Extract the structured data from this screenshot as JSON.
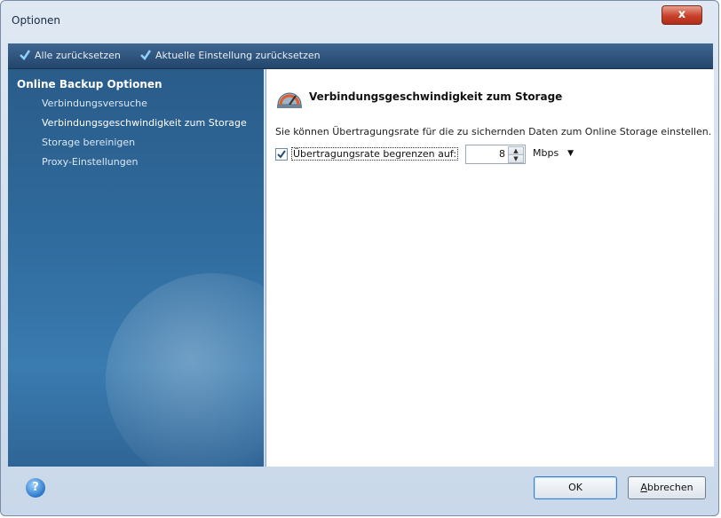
{
  "window": {
    "title": "Optionen",
    "close_symbol": "x"
  },
  "toolbar": {
    "reset_all": "Alle zurücksetzen",
    "reset_current": "Aktuelle Einstellung zurücksetzen"
  },
  "sidebar": {
    "section_title": "Online Backup Optionen",
    "items": [
      {
        "label": "Verbindungsversuche"
      },
      {
        "label": "Verbindungsgeschwindigkeit zum Storage"
      },
      {
        "label": "Storage bereinigen"
      },
      {
        "label": "Proxy-Einstellungen"
      }
    ]
  },
  "content": {
    "heading": "Verbindungsgeschwindigkeit zum Storage",
    "description": "Sie können Übertragungsrate für die zu sichernden Daten zum Online Storage einstellen.",
    "limit_checkbox": {
      "label": "Übertragungsrate begrenzen auf:",
      "checked": true
    },
    "rate_value": "8",
    "rate_unit": "Mbps"
  },
  "footer": {
    "ok_label": "OK",
    "cancel_label_first": "A",
    "cancel_label_rest": "bbrechen"
  },
  "colors": {
    "toolbar": "#2c4f78",
    "sidebar": "#2f6a9c",
    "content_bg": "#ffffff",
    "close": "#c8412a"
  }
}
